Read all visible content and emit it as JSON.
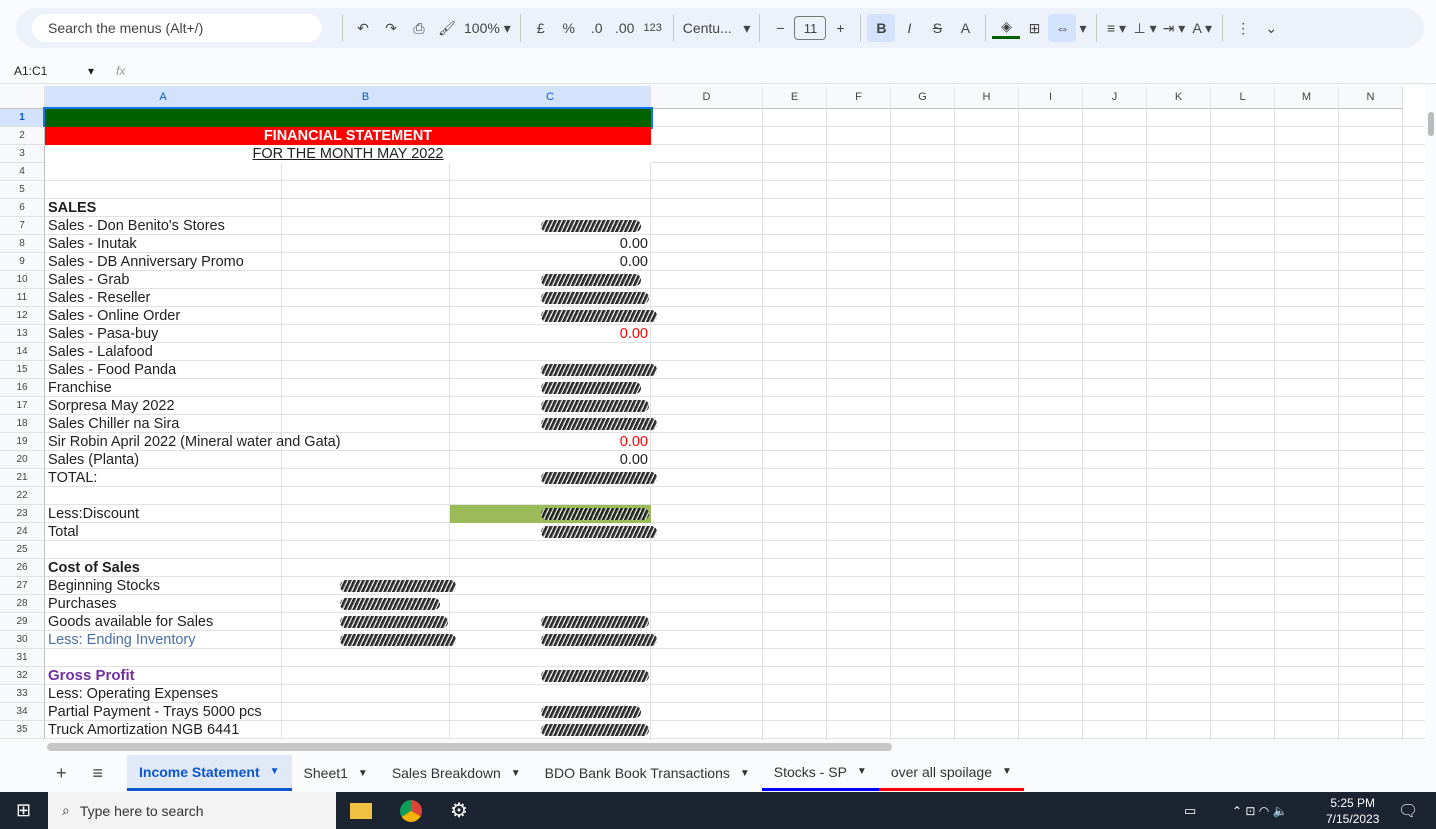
{
  "toolbar": {
    "search_placeholder": "Search the menus (Alt+/)",
    "zoom": "100%",
    "currency": "£",
    "percent": "%",
    "dec_decrease": ".0",
    "dec_increase": ".00",
    "format_123": "123",
    "font": "Centu...",
    "font_size": "11",
    "bold": "B",
    "italic": "I",
    "strike": "S",
    "text_color": "A"
  },
  "formula_bar": {
    "cell_ref": "A1:C1",
    "fx": "fx"
  },
  "columns": [
    "A",
    "B",
    "C",
    "D",
    "E",
    "F",
    "G",
    "H",
    "I",
    "J",
    "K",
    "L",
    "M",
    "N"
  ],
  "rows": [
    {
      "a": ""
    },
    {
      "title": "FINANCIAL STATEMENT"
    },
    {
      "subtitle": "FOR THE MONTH MAY 2022"
    },
    {
      "a": ""
    },
    {
      "a": ""
    },
    {
      "a": "SALES",
      "bold": true
    },
    {
      "a": "Sales - Don Benito's Stores",
      "c": "redacted"
    },
    {
      "a": "Sales - Inutak",
      "c": "0.00"
    },
    {
      "a": "Sales - DB Anniversary Promo",
      "c": "0.00"
    },
    {
      "a": "Sales - Grab",
      "c": "redacted"
    },
    {
      "a": "Sales - Reseller",
      "c": "redacted"
    },
    {
      "a": "Sales - Online Order",
      "c": "redacted"
    },
    {
      "a": "Sales - Pasa-buy",
      "c": "0.00",
      "red": true
    },
    {
      "a": "Sales - Lalafood"
    },
    {
      "a": "Sales - Food Panda",
      "c": "redacted"
    },
    {
      "a": "Franchise",
      "c": "redacted"
    },
    {
      "a": "Sorpresa May 2022",
      "c": "redacted"
    },
    {
      "a": "Sales Chiller na Sira",
      "c": "redacted"
    },
    {
      "a": "Sir Robin April 2022 (Mineral water and Gata)",
      "c": "0.00",
      "red": true
    },
    {
      "a": "Sales (Planta)",
      "c": "0.00"
    },
    {
      "a": "TOTAL:",
      "c": "redacted"
    },
    {
      "a": ""
    },
    {
      "a": "Less:Discount",
      "c": "redacted",
      "green": true
    },
    {
      "a": "Total",
      "c": "redacted"
    },
    {
      "a": ""
    },
    {
      "a": "Cost of Sales",
      "bold": true
    },
    {
      "a": "Beginning Stocks",
      "b": "redacted"
    },
    {
      "a": "Purchases",
      "b": "redacted"
    },
    {
      "a": "Goods available for Sales",
      "b": "redacted",
      "c": "redacted"
    },
    {
      "a": "Less: Ending Inventory",
      "b": "redacted",
      "c": "redacted",
      "blue": true
    },
    {
      "a": ""
    },
    {
      "a": "Gross Profit",
      "c": "redacted",
      "purple": true
    },
    {
      "a": "Less: Operating Expenses"
    },
    {
      "a": "Partial Payment - Trays 5000 pcs",
      "c": "redacted"
    },
    {
      "a": "Truck Amortization NGB 6441",
      "c": "redacted"
    }
  ],
  "sheet_tabs": [
    {
      "label": "Income Statement",
      "active": true
    },
    {
      "label": "Sheet1"
    },
    {
      "label": "Sales Breakdown"
    },
    {
      "label": "BDO Bank Book Transactions"
    },
    {
      "label": "Stocks - SP",
      "color": "#0000ff"
    },
    {
      "label": "over all spoilage",
      "color": "#ff0000"
    }
  ],
  "taskbar": {
    "search_placeholder": "Type here to search",
    "time": "5:25 PM",
    "date": "7/15/2023"
  },
  "colors": {
    "header_fill": "#006100",
    "title_fill": "#ff0000",
    "discount_fill": "#9bbb59",
    "gross_profit": "#7030a0",
    "negative": "#ff0000"
  }
}
